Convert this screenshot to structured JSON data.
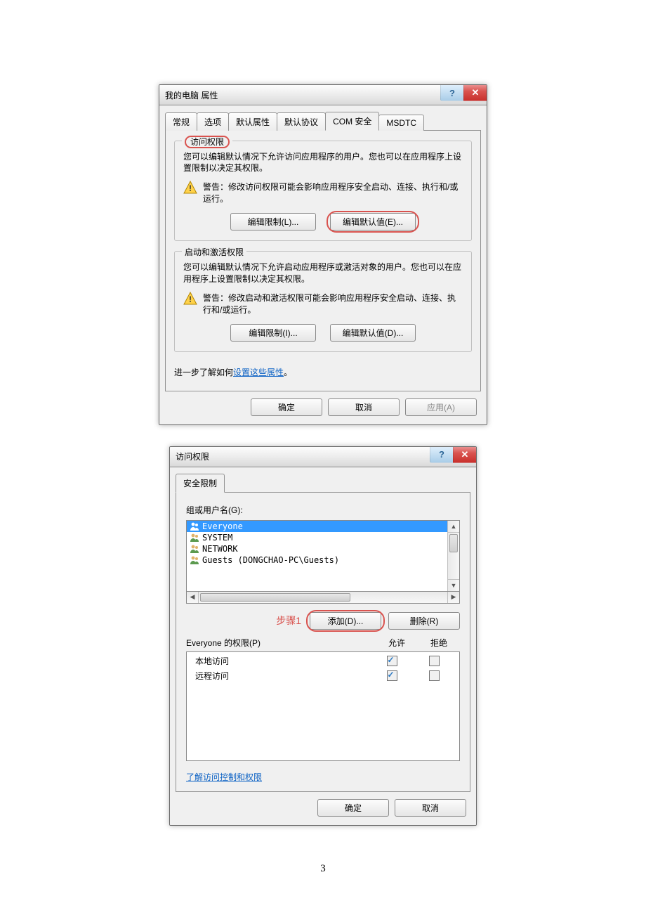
{
  "page_number": "3",
  "dialog1": {
    "title": "我的电脑 属性",
    "tabs": [
      "常规",
      "选项",
      "默认属性",
      "默认协议",
      "COM 安全",
      "MSDTC"
    ],
    "active_tab_index": 4,
    "access_group": {
      "legend": "访问权限",
      "desc": "您可以编辑默认情况下允许访问应用程序的用户。您也可以在应用程序上设置限制以决定其权限。",
      "warn": "警告：修改访问权限可能会影响应用程序安全启动、连接、执行和/或运行。",
      "btn_limit": "编辑限制(L)...",
      "btn_default": "编辑默认值(E)..."
    },
    "launch_group": {
      "legend": "启动和激活权限",
      "desc": "您可以编辑默认情况下允许启动应用程序或激活对象的用户。您也可以在应用程序上设置限制以决定其权限。",
      "warn": "警告：修改启动和激活权限可能会影响应用程序安全启动、连接、执行和/或运行。",
      "btn_limit": "编辑限制(I)...",
      "btn_default": "编辑默认值(D)..."
    },
    "learn_prefix": "进一步了解如何",
    "learn_link": "设置这些属性",
    "learn_suffix": "。",
    "ok": "确定",
    "cancel": "取消",
    "apply": "应用(A)"
  },
  "dialog2": {
    "title": "访问权限",
    "tab": "安全限制",
    "group_label": "组或用户名(G):",
    "users": [
      {
        "name": "Everyone",
        "selected": true
      },
      {
        "name": "SYSTEM",
        "selected": false
      },
      {
        "name": "NETWORK",
        "selected": false
      },
      {
        "name": "Guests (DONGCHAO-PC\\Guests)",
        "selected": false
      }
    ],
    "step_label": "步骤1",
    "btn_add": "添加(D)...",
    "btn_remove": "删除(R)",
    "perm_label": "Everyone 的权限(P)",
    "col_allow": "允许",
    "col_deny": "拒绝",
    "perms": [
      {
        "name": "本地访问",
        "allow": true,
        "deny": false
      },
      {
        "name": "远程访问",
        "allow": true,
        "deny": false
      }
    ],
    "learn_link": "了解访问控制和权限",
    "ok": "确定",
    "cancel": "取消"
  }
}
